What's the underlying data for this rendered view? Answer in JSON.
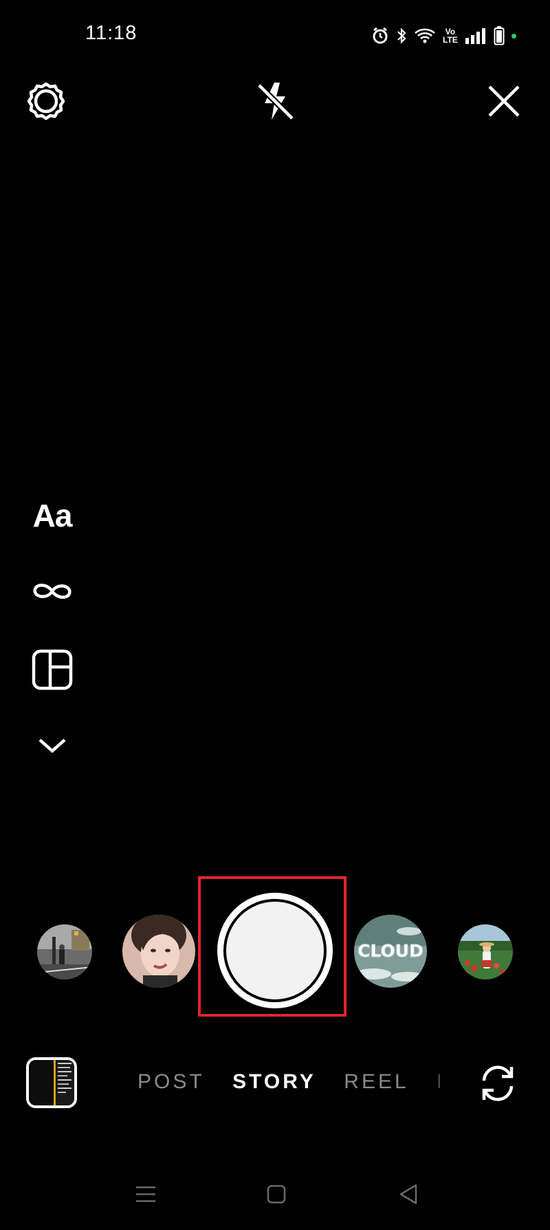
{
  "status_bar": {
    "time": "11:18",
    "network_label": "Vo\nLTE",
    "icons": [
      "alarm-icon",
      "bluetooth-icon",
      "wifi-icon",
      "volte-icon",
      "signal-icon",
      "battery-icon",
      "notification-dot"
    ]
  },
  "top_bar": {
    "settings_icon": "gear-icon",
    "flash_icon": "flash-off-icon",
    "close_icon": "close-icon"
  },
  "left_tools": {
    "text_tool_label": "Aa",
    "boomerang_icon": "infinity-icon",
    "layout_icon": "layout-icon",
    "more_icon": "chevron-down-icon"
  },
  "effects": [
    {
      "name": "street-effect",
      "colors": [
        "#555555",
        "#a8a8a8"
      ]
    },
    {
      "name": "portrait-effect",
      "colors": [
        "#c98d7a",
        "#f0d2c6"
      ]
    },
    {
      "name": "cloud-effect",
      "label": "CLOUD",
      "colors": [
        "#6f8c86",
        "#d9e6e4"
      ]
    },
    {
      "name": "garden-effect",
      "colors": [
        "#2f6b2f",
        "#c0392b"
      ]
    }
  ],
  "modes": {
    "items": [
      "POST",
      "STORY",
      "REEL",
      "LI"
    ],
    "active": "STORY"
  },
  "bottom_bar": {
    "flip_icon": "flip-camera-icon",
    "gallery_icon": "gallery-thumbnail"
  },
  "nav_bar": {
    "icons": [
      "menu-icon",
      "home-icon",
      "back-icon"
    ]
  },
  "colors": {
    "background": "#000000",
    "highlight": "#e0262b",
    "status_dot": "#2ecc71"
  }
}
